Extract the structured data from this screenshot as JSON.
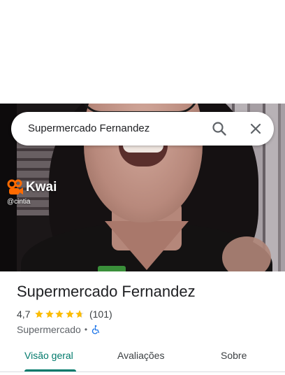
{
  "search": {
    "query": "Supermercado Fernandez",
    "search_icon": "search-icon",
    "close_icon": "close-icon"
  },
  "photo": {
    "watermark_brand": "Kwai",
    "watermark_user": "@cintia"
  },
  "place": {
    "name": "Supermercado Fernandez",
    "rating": "4,7",
    "rating_value": 4.7,
    "review_count": "(101)",
    "category": "Supermercado",
    "separator": "•",
    "accessibility_icon": "wheelchair-icon"
  },
  "tabs": [
    {
      "label": "Visão geral",
      "active": true
    },
    {
      "label": "Avaliações",
      "active": false
    },
    {
      "label": "Sobre",
      "active": false
    }
  ],
  "colors": {
    "accent": "#00796b",
    "star": "#fbbc04",
    "accessibility": "#1a73e8"
  }
}
